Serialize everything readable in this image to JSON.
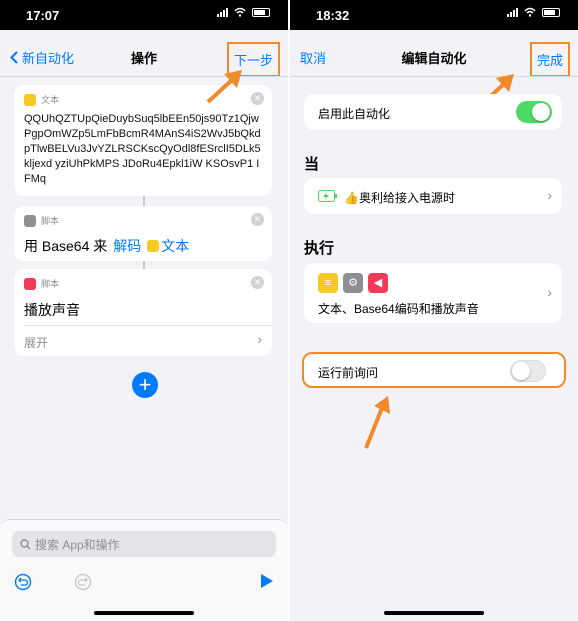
{
  "left": {
    "status_time": "17:07",
    "nav": {
      "back_label": "新自动化",
      "title": "操作",
      "next_label": "下一步"
    },
    "text_card": {
      "kind": "文本",
      "content": "QQUhQZTUpQieDuybSuq5lbEEn50js90Tz1QjwPgpOmWZp5LmFbBcmR4MAnS4iS2WvJ5bQkdpTlwBELVu3JvYZLRSCKscQyOdl8fESrclI5DLk5kljexd yziUhPkMPS JDoRu4Epkl1iW KSOsvP1 IFMq"
    },
    "base64_card": {
      "kind": "脚本",
      "prefix": "用 Base64 来",
      "action": "解码",
      "param": "文本"
    },
    "sound_card": {
      "kind": "脚本",
      "title": "播放声音",
      "expand": "展开"
    },
    "search_placeholder": "搜索 App和操作",
    "colors": {
      "accent": "#007aff",
      "highlight": "#f08a2a"
    }
  },
  "right": {
    "status_time": "18:32",
    "nav": {
      "cancel_label": "取消",
      "title": "编辑自动化",
      "done_label": "完成"
    },
    "enable_label": "启用此自动化",
    "enable_on": true,
    "when_heading": "当",
    "trigger_label": "👍奥利给接入电源时",
    "do_heading": "执行",
    "actions_summary": "文本、Base64编码和播放声音",
    "ask_label": "运行前询问",
    "ask_on": false
  }
}
